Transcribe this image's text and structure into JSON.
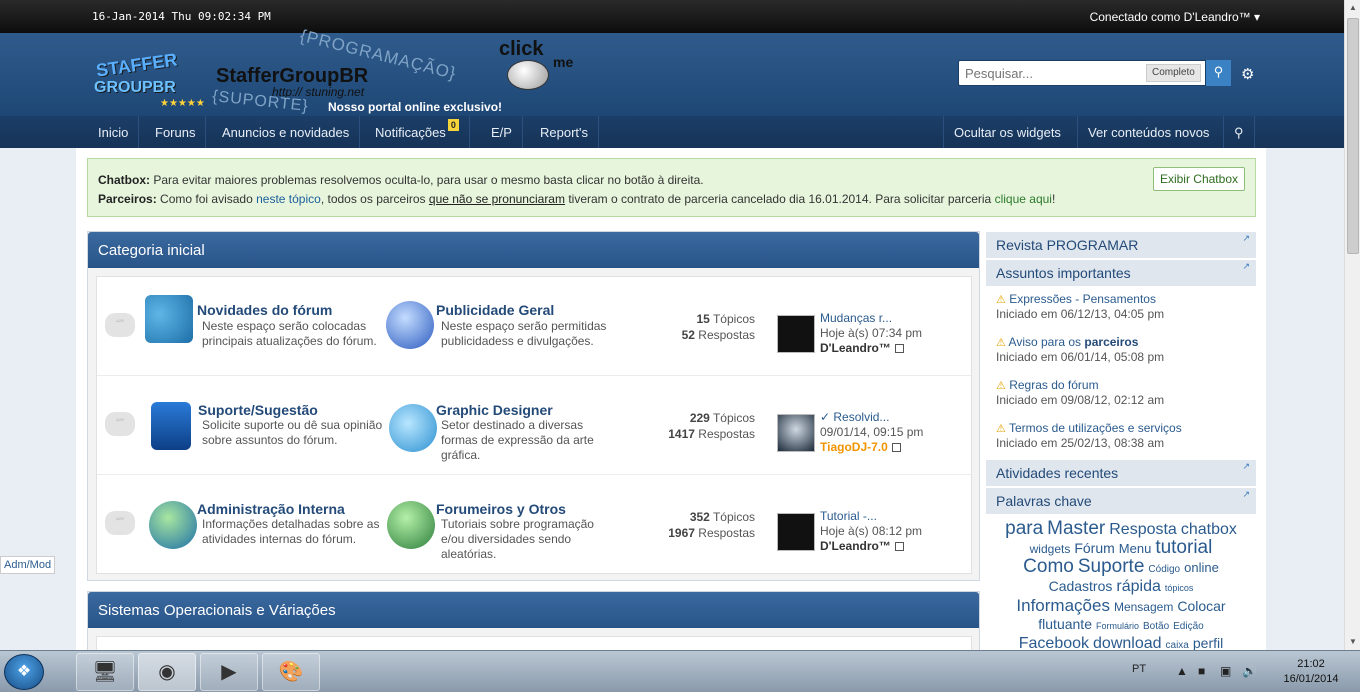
{
  "topbar": {
    "datetime": "16-Jan-2014 Thu 09:02:34 PM",
    "connected": "Conectado como D'Leandro™ ▾"
  },
  "header": {
    "logo_left_top": "STAFFER",
    "logo_left_bottom": "GROUPBR",
    "logo_stars": "★★★★★",
    "logo_name": "StafferGroupBR",
    "logo_url": "http:// stuning.net",
    "logo_prog": "{PROGRAMAÇÃO}",
    "logo_sup": "{SUPORTE}",
    "tagline": "Nosso portal online exclusivo!",
    "click_text": "click",
    "click_me": "me",
    "search_placeholder": "Pesquisar...",
    "search_mode": "Completo",
    "colors": {
      "header_bg": "#2f5b8c",
      "nav_bg": "#1b3e68",
      "accent": "#3a82c4"
    }
  },
  "nav": {
    "items": [
      "Inicio",
      "Foruns",
      "Anuncios e novidades",
      "Notificações",
      "E/P",
      "Report's"
    ],
    "notifications_count": "0",
    "right_items": [
      "Ocultar os widgets",
      "Ver conteúdos novos"
    ]
  },
  "notice": {
    "chatbox_label": "Chatbox:",
    "chatbox_text": "Para evitar maiores problemas resolvemos oculta-lo, para usar o mesmo basta clicar no botão à direita.",
    "partners_label": "Parceiros:",
    "partners_t1": "Como foi avisado",
    "partners_link1": "neste tópico",
    "partners_t2": ", todos os parceiros",
    "partners_link2": "que não se pronunciaram",
    "partners_t3": "tiveram o contrato de parceria cancelado dia 16.01.2014. Para solicitar parceria",
    "partners_link3": "clique aqui",
    "partners_t4": "!",
    "chat_button": "Exibir Chatbox"
  },
  "category1": {
    "title": "Categoria inicial",
    "rows": [
      {
        "left_title": "Novidades do fórum",
        "left_desc": "Neste espaço serão colocadas principais atualizações do fórum.",
        "right_title": "Publicidade Geral",
        "right_desc": "Neste espaço serão permitidas publicidadess e divulgações.",
        "topics": "15",
        "topics_label": "Tópicos",
        "replies": "52",
        "replies_label": "Respostas",
        "last_title": "Mudanças r...",
        "last_date": "Hoje à(s) 07:34 pm",
        "last_user": "D'Leandro™"
      },
      {
        "left_title": "Suporte/Sugestão",
        "left_desc": "Solicite suporte ou dê sua opinião sobre assuntos do fórum.",
        "right_title": "Graphic Designer",
        "right_desc": "Setor destinado a diversas formas de expressão da arte gráfica.",
        "topics": "229",
        "topics_label": "Tópicos",
        "replies": "1417",
        "replies_label": "Respostas",
        "last_title": "✓ Resolvid...",
        "last_date": "09/01/14, 09:15 pm",
        "last_user": "TiagoDJ-7.0"
      },
      {
        "left_title": "Administração Interna",
        "left_desc": "Informações detalhadas sobre as atividades internas do fórum.",
        "right_title": "Forumeiros y Otros",
        "right_desc": "Tutoriais sobre programação e/ou diversidades sendo aleatórias.",
        "topics": "352",
        "topics_label": "Tópicos",
        "replies": "1967",
        "replies_label": "Respostas",
        "last_title": "Tutorial -...",
        "last_date": "Hoje à(s) 08:12 pm",
        "last_user": "D'Leandro™"
      }
    ]
  },
  "category2": {
    "title": "Sistemas Operacionais e Váriações"
  },
  "sidebar": {
    "revista": "Revista PROGRAMAR",
    "importantes": "Assuntos importantes",
    "imp_items": [
      {
        "title": "Expressões - Pensamentos",
        "date": "Iniciado em 06/12/13, 04:05 pm"
      },
      {
        "title_a": "Aviso para os",
        "title_b": "parceiros",
        "date": "Iniciado em 06/01/14, 05:08 pm"
      },
      {
        "title": "Regras do fórum",
        "date": "Iniciado em 09/08/12, 02:12 am"
      },
      {
        "title": "Termos de utilizações e serviços",
        "date": "Iniciado em 25/02/13, 08:38 am"
      }
    ],
    "atividades": "Atividades recentes",
    "palavras": "Palavras chave",
    "tags": [
      "para",
      "Master",
      "Resposta",
      "chatbox",
      "widgets",
      "Fórum",
      "Menu",
      "tutorial",
      "Como",
      "Suporte",
      "Código",
      "online",
      "Cadastros",
      "rápida",
      "tópicos",
      "Informações",
      "Mensagem",
      "Colocar",
      "flutuante",
      "Formulário",
      "Botão",
      "Edição",
      "Facebook",
      "download",
      "caixa",
      "perfil"
    ]
  },
  "admmod": "Adm/Mod",
  "taskbar": {
    "lang": "PT",
    "time": "21:02",
    "date": "16/01/2014"
  }
}
